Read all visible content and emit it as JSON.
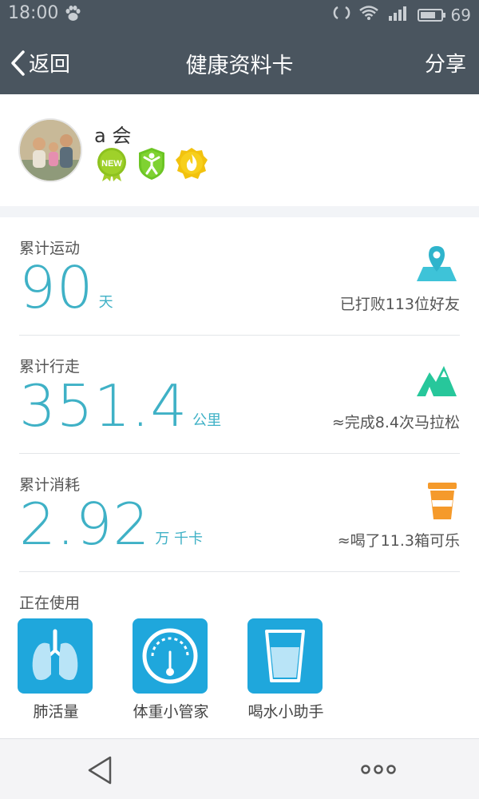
{
  "status": {
    "time": "18:00",
    "battery": "69"
  },
  "nav": {
    "back_label": "返回",
    "title": "健康资料卡",
    "share_label": "分享"
  },
  "profile": {
    "name": "a 会",
    "badges": [
      "NEW",
      "exercise",
      "flame"
    ]
  },
  "stats": [
    {
      "label": "累计运动",
      "value": "90",
      "unit": "天",
      "desc": "已打败113位好友",
      "icon": "location-map-icon",
      "icon_color": "#3ec3d8"
    },
    {
      "label": "累计行走",
      "value": "351.4",
      "unit": "公里",
      "desc": "≈完成8.4次马拉松",
      "icon": "mountain-icon",
      "icon_color": "#27c79b"
    },
    {
      "label": "累计消耗",
      "value": "2.92",
      "unit": "万 千卡",
      "desc": "≈喝了11.3箱可乐",
      "icon": "cup-icon",
      "icon_color": "#f59a2b"
    }
  ],
  "using": {
    "label": "正在使用",
    "apps": [
      {
        "name": "肺活量",
        "icon": "lungs-icon"
      },
      {
        "name": "体重小管家",
        "icon": "scale-gauge-icon"
      },
      {
        "name": "喝水小助手",
        "icon": "water-glass-icon"
      }
    ]
  },
  "colors": {
    "nav_bg": "#4a555f",
    "accent": "#3fb1c6",
    "app_tile": "#1fa7dc"
  }
}
